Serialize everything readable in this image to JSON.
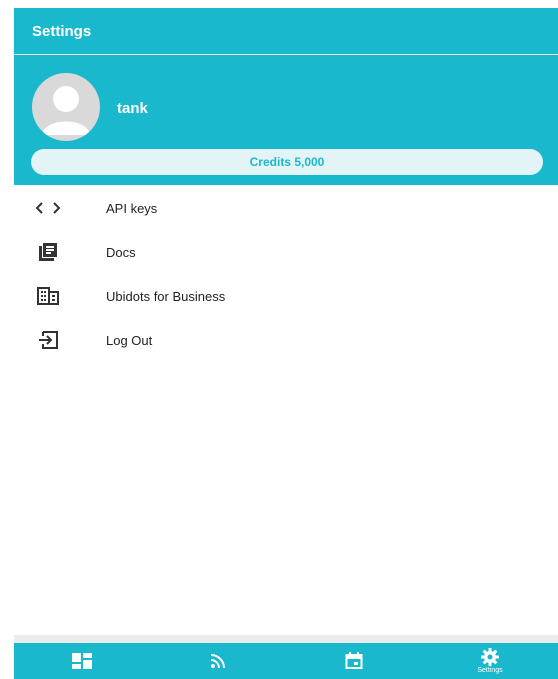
{
  "header": {
    "title": "Settings"
  },
  "profile": {
    "username": "tank",
    "credits_label": "Credits 5,000"
  },
  "menu": {
    "items": [
      {
        "label": "API keys",
        "icon": "code-icon"
      },
      {
        "label": "Docs",
        "icon": "docs-icon"
      },
      {
        "label": "Ubidots for Business",
        "icon": "business-icon"
      },
      {
        "label": "Log Out",
        "icon": "logout-icon"
      }
    ]
  },
  "bottom_nav": {
    "tabs": [
      {
        "icon": "dashboard-icon",
        "label": ""
      },
      {
        "icon": "rss-feed-icon",
        "label": ""
      },
      {
        "icon": "calendar-icon",
        "label": ""
      },
      {
        "icon": "gear-icon",
        "label": "Settings"
      }
    ]
  },
  "colors": {
    "primary": "#1ab8cc",
    "credits_bg": "#e3f4f6",
    "text": "#222222"
  }
}
